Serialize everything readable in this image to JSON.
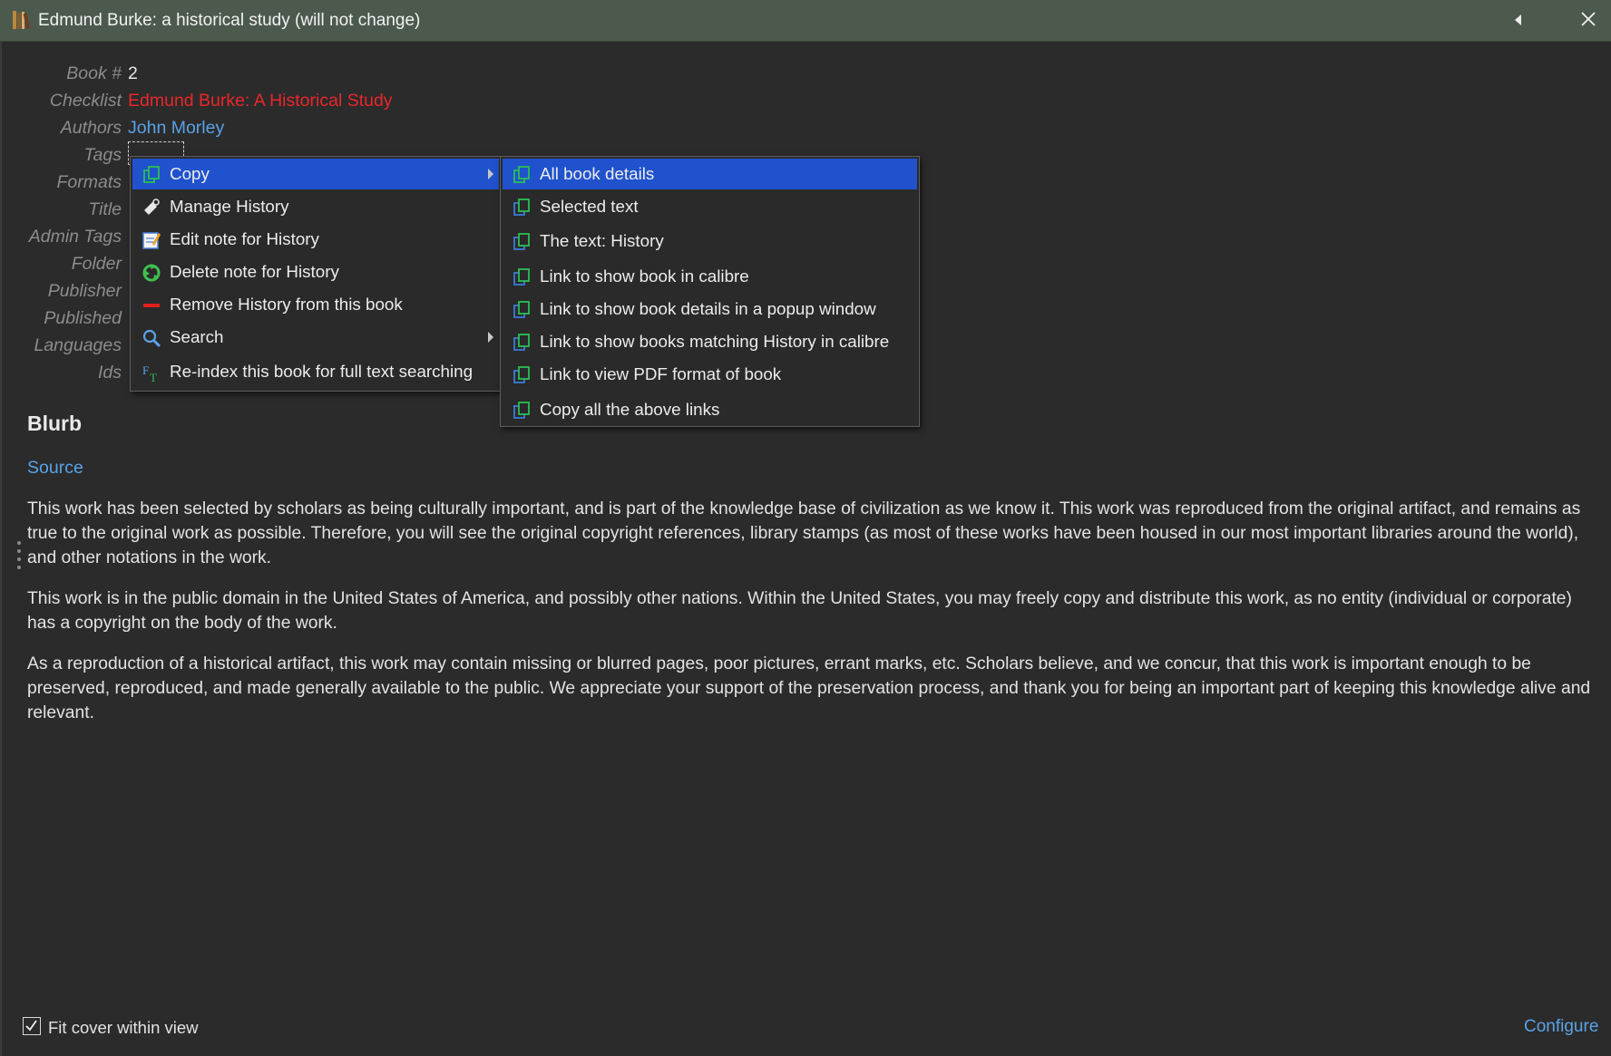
{
  "window": {
    "title": "Edmund Burke: a historical study (will not change)"
  },
  "metadata": {
    "rows": [
      {
        "label": "Book #",
        "value": "2"
      },
      {
        "label": "Checklist",
        "value": "Edmund Burke: A Historical Study"
      },
      {
        "label": "Authors",
        "value": "John Morley"
      },
      {
        "label": "Tags",
        "value": ""
      },
      {
        "label": "Formats",
        "value": ""
      },
      {
        "label": "Title",
        "value": ""
      },
      {
        "label": "Admin Tags",
        "value": ""
      },
      {
        "label": "Folder",
        "value": ""
      },
      {
        "label": "Publisher",
        "value": ""
      },
      {
        "label": "Published",
        "value": ""
      },
      {
        "label": "Languages",
        "value": ""
      },
      {
        "label": "Ids",
        "value": ""
      }
    ]
  },
  "context_menu": {
    "items": [
      {
        "label": "Copy",
        "icon": "copy-icon"
      },
      {
        "label": "Manage History",
        "icon": "manage-tag-icon"
      },
      {
        "label": "Edit note for History",
        "icon": "edit-note-icon"
      },
      {
        "label": "Delete note for History",
        "icon": "recycle-icon"
      },
      {
        "label": "Remove History from this book",
        "icon": "remove-icon"
      },
      {
        "label": "Search",
        "icon": "search-icon"
      },
      {
        "label": "Re-index this book for full text searching",
        "icon": "fulltext-index-icon"
      }
    ]
  },
  "copy_submenu": {
    "items": [
      {
        "label": "All book details"
      },
      {
        "label": "Selected text"
      },
      {
        "label": "The text: History"
      },
      {
        "label": "Link to show book in calibre"
      },
      {
        "label": "Link to show book details in a popup window"
      },
      {
        "label": "Link to show books matching History in calibre"
      },
      {
        "label": "Link to view PDF format of book"
      },
      {
        "label": "Copy all the above links"
      }
    ]
  },
  "blurb": {
    "title": "Blurb",
    "source": "Source",
    "paragraphs": [
      "This work has been selected by scholars as being culturally important, and is part of the knowledge base of civilization as we know it. This work was reproduced from the original artifact, and remains as true to the original work as possible. Therefore, you will see the original copyright references, library stamps (as most of these works have been housed in our most important libraries around the world), and other notations in the work.",
      "This work is in the public domain in the United States of America, and possibly other nations. Within the United States, you may freely copy and distribute this work, as no entity (individual or corporate) has a copyright on the body of the work.",
      "As a reproduction of a historical artifact, this work may contain missing or blurred pages, poor pictures, errant marks, etc. Scholars believe, and we concur, that this work is important enough to be preserved, reproduced, and made generally available to the public. We appreciate your support of the preservation process, and thank you for being an important part of keeping this knowledge alive and relevant."
    ]
  },
  "footer": {
    "fit_cover_label": "Fit cover within view",
    "fit_cover_checked": true,
    "configure_label": "Configure"
  },
  "colors": {
    "title_bar": "#4c5a4e",
    "background": "#2b2b2b",
    "link": "#5aa2e6",
    "checklist_value": "#e8272b",
    "menu_highlight": "#1f52cc"
  }
}
